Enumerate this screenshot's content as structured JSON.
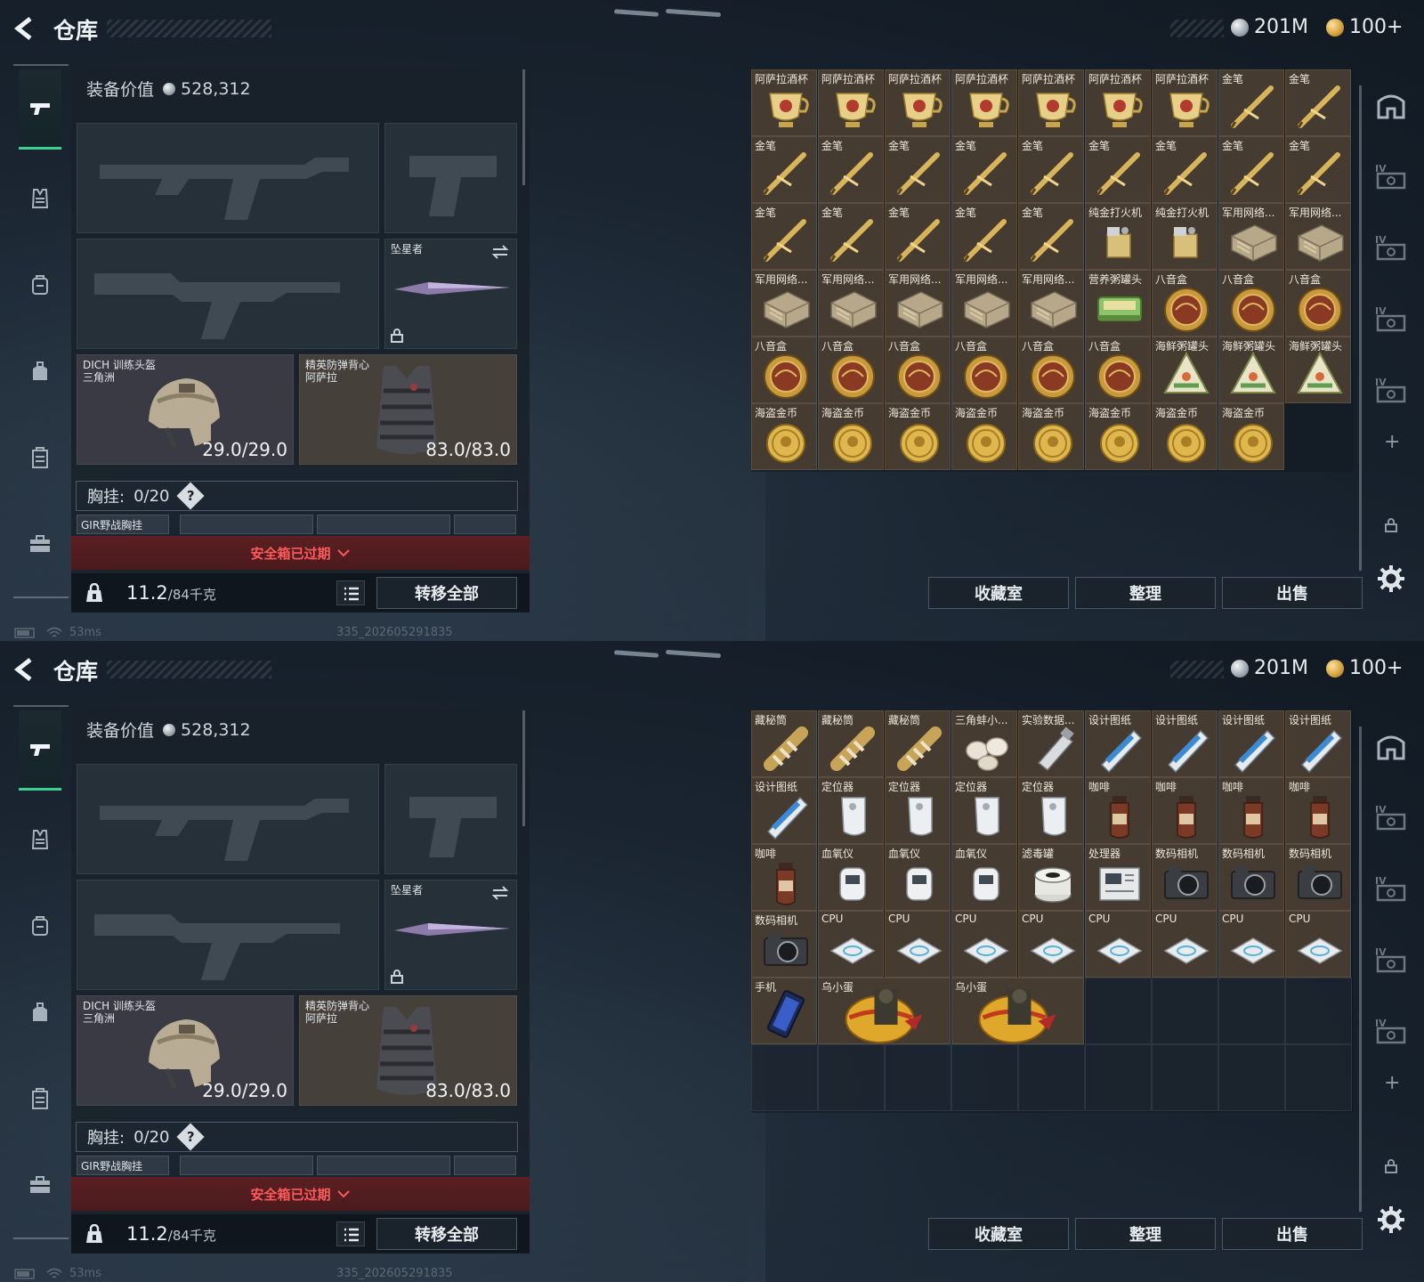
{
  "header": {
    "title": "仓库",
    "silver_amount": "201M",
    "gold_amount": "100+"
  },
  "equipment": {
    "value_label": "装备价值",
    "value": "528,312",
    "melee_name": "坠星者",
    "helmet_name": "DICH 训练头盔",
    "helmet_sub": "三角洲",
    "helmet_durability": "29.0/29.0",
    "armor_name": "精英防弹背心",
    "armor_sub": "阿萨拉",
    "armor_durability": "83.0/83.0",
    "rig_label": "胸挂:",
    "rig_capacity": "0/20",
    "rig_help": "?",
    "rig_item": "GIR野战胸挂",
    "safe_expired": "安全箱已过期",
    "weight": "11.2",
    "weight_max": "/84千克",
    "transfer_all": "转移全部"
  },
  "actions": {
    "collection": "收藏室",
    "sort": "整理",
    "sell": "出售"
  },
  "status": {
    "ping": "53ms",
    "build": "335_202605291835"
  },
  "colors": {
    "accent_green": "#3ad18a",
    "warning_red": "#ff5a5a",
    "item_bg": "#463b31"
  },
  "screens": [
    {
      "items": [
        {
          "label": "阿萨拉酒杯",
          "icon": "cup"
        },
        {
          "label": "阿萨拉酒杯",
          "icon": "cup"
        },
        {
          "label": "阿萨拉酒杯",
          "icon": "cup"
        },
        {
          "label": "阿萨拉酒杯",
          "icon": "cup"
        },
        {
          "label": "阿萨拉酒杯",
          "icon": "cup"
        },
        {
          "label": "阿萨拉酒杯",
          "icon": "cup"
        },
        {
          "label": "阿萨拉酒杯",
          "icon": "cup"
        },
        {
          "label": "金笔",
          "icon": "pen"
        },
        {
          "label": "金笔",
          "icon": "pen"
        },
        {
          "label": "金笔",
          "icon": "pen"
        },
        {
          "label": "金笔",
          "icon": "pen"
        },
        {
          "label": "金笔",
          "icon": "pen"
        },
        {
          "label": "金笔",
          "icon": "pen"
        },
        {
          "label": "金笔",
          "icon": "pen"
        },
        {
          "label": "金笔",
          "icon": "pen"
        },
        {
          "label": "金笔",
          "icon": "pen"
        },
        {
          "label": "金笔",
          "icon": "pen"
        },
        {
          "label": "金笔",
          "icon": "pen"
        },
        {
          "label": "金笔",
          "icon": "pen"
        },
        {
          "label": "金笔",
          "icon": "pen"
        },
        {
          "label": "金笔",
          "icon": "pen"
        },
        {
          "label": "金笔",
          "icon": "pen"
        },
        {
          "label": "金笔",
          "icon": "pen"
        },
        {
          "label": "纯金打火机",
          "icon": "lighter"
        },
        {
          "label": "纯金打火机",
          "icon": "lighter"
        },
        {
          "label": "军用网络...",
          "icon": "network"
        },
        {
          "label": "军用网络...",
          "icon": "network"
        },
        {
          "label": "军用网络...",
          "icon": "network"
        },
        {
          "label": "军用网络...",
          "icon": "network"
        },
        {
          "label": "军用网络...",
          "icon": "network"
        },
        {
          "label": "军用网络...",
          "icon": "network"
        },
        {
          "label": "军用网络...",
          "icon": "network"
        },
        {
          "label": "营养粥罐头",
          "icon": "can"
        },
        {
          "label": "八音盒",
          "icon": "musicbox"
        },
        {
          "label": "八音盒",
          "icon": "musicbox"
        },
        {
          "label": "八音盒",
          "icon": "musicbox"
        },
        {
          "label": "八音盒",
          "icon": "musicbox"
        },
        {
          "label": "八音盒",
          "icon": "musicbox"
        },
        {
          "label": "八音盒",
          "icon": "musicbox"
        },
        {
          "label": "八音盒",
          "icon": "musicbox"
        },
        {
          "label": "八音盒",
          "icon": "musicbox"
        },
        {
          "label": "八音盒",
          "icon": "musicbox"
        },
        {
          "label": "海鲜粥罐头",
          "icon": "seafood"
        },
        {
          "label": "海鲜粥罐头",
          "icon": "seafood"
        },
        {
          "label": "海鲜粥罐头",
          "icon": "seafood"
        },
        {
          "label": "海盗金币",
          "icon": "coin"
        },
        {
          "label": "海盗金币",
          "icon": "coin"
        },
        {
          "label": "海盗金币",
          "icon": "coin"
        },
        {
          "label": "海盗金币",
          "icon": "coin"
        },
        {
          "label": "海盗金币",
          "icon": "coin"
        },
        {
          "label": "海盗金币",
          "icon": "coin"
        },
        {
          "label": "海盗金币",
          "icon": "coin"
        },
        {
          "label": "海盗金币",
          "icon": "coin"
        }
      ],
      "empty_cells": 0
    },
    {
      "items": [
        {
          "label": "藏秘筒",
          "icon": "cryptex"
        },
        {
          "label": "藏秘筒",
          "icon": "cryptex"
        },
        {
          "label": "藏秘筒",
          "icon": "cryptex"
        },
        {
          "label": "三角蚌小...",
          "icon": "pearl"
        },
        {
          "label": "实验数据...",
          "icon": "usb"
        },
        {
          "label": "设计图纸",
          "icon": "blueprint"
        },
        {
          "label": "设计图纸",
          "icon": "blueprint"
        },
        {
          "label": "设计图纸",
          "icon": "blueprint"
        },
        {
          "label": "设计图纸",
          "icon": "blueprint"
        },
        {
          "label": "设计图纸",
          "icon": "blueprint"
        },
        {
          "label": "定位器",
          "icon": "locator"
        },
        {
          "label": "定位器",
          "icon": "locator"
        },
        {
          "label": "定位器",
          "icon": "locator"
        },
        {
          "label": "定位器",
          "icon": "locator"
        },
        {
          "label": "咖啡",
          "icon": "coffee"
        },
        {
          "label": "咖啡",
          "icon": "coffee"
        },
        {
          "label": "咖啡",
          "icon": "coffee"
        },
        {
          "label": "咖啡",
          "icon": "coffee"
        },
        {
          "label": "咖啡",
          "icon": "coffee"
        },
        {
          "label": "血氧仪",
          "icon": "oximeter"
        },
        {
          "label": "血氧仪",
          "icon": "oximeter"
        },
        {
          "label": "血氧仪",
          "icon": "oximeter"
        },
        {
          "label": "滤毒罐",
          "icon": "filter"
        },
        {
          "label": "处理器",
          "icon": "processor"
        },
        {
          "label": "数码相机",
          "icon": "camera"
        },
        {
          "label": "数码相机",
          "icon": "camera"
        },
        {
          "label": "数码相机",
          "icon": "camera"
        },
        {
          "label": "数码相机",
          "icon": "camera"
        },
        {
          "label": "CPU",
          "icon": "cpu"
        },
        {
          "label": "CPU",
          "icon": "cpu"
        },
        {
          "label": "CPU",
          "icon": "cpu"
        },
        {
          "label": "CPU",
          "icon": "cpu"
        },
        {
          "label": "CPU",
          "icon": "cpu"
        },
        {
          "label": "CPU",
          "icon": "cpu"
        },
        {
          "label": "CPU",
          "icon": "cpu"
        },
        {
          "label": "CPU",
          "icon": "cpu"
        },
        {
          "label": "手机",
          "icon": "phone"
        },
        {
          "label": "乌小蛋",
          "icon": "egg",
          "wide": 2
        },
        {
          "label": "乌小蛋",
          "icon": "egg",
          "wide": 2
        }
      ],
      "empty_cells": 13
    }
  ]
}
